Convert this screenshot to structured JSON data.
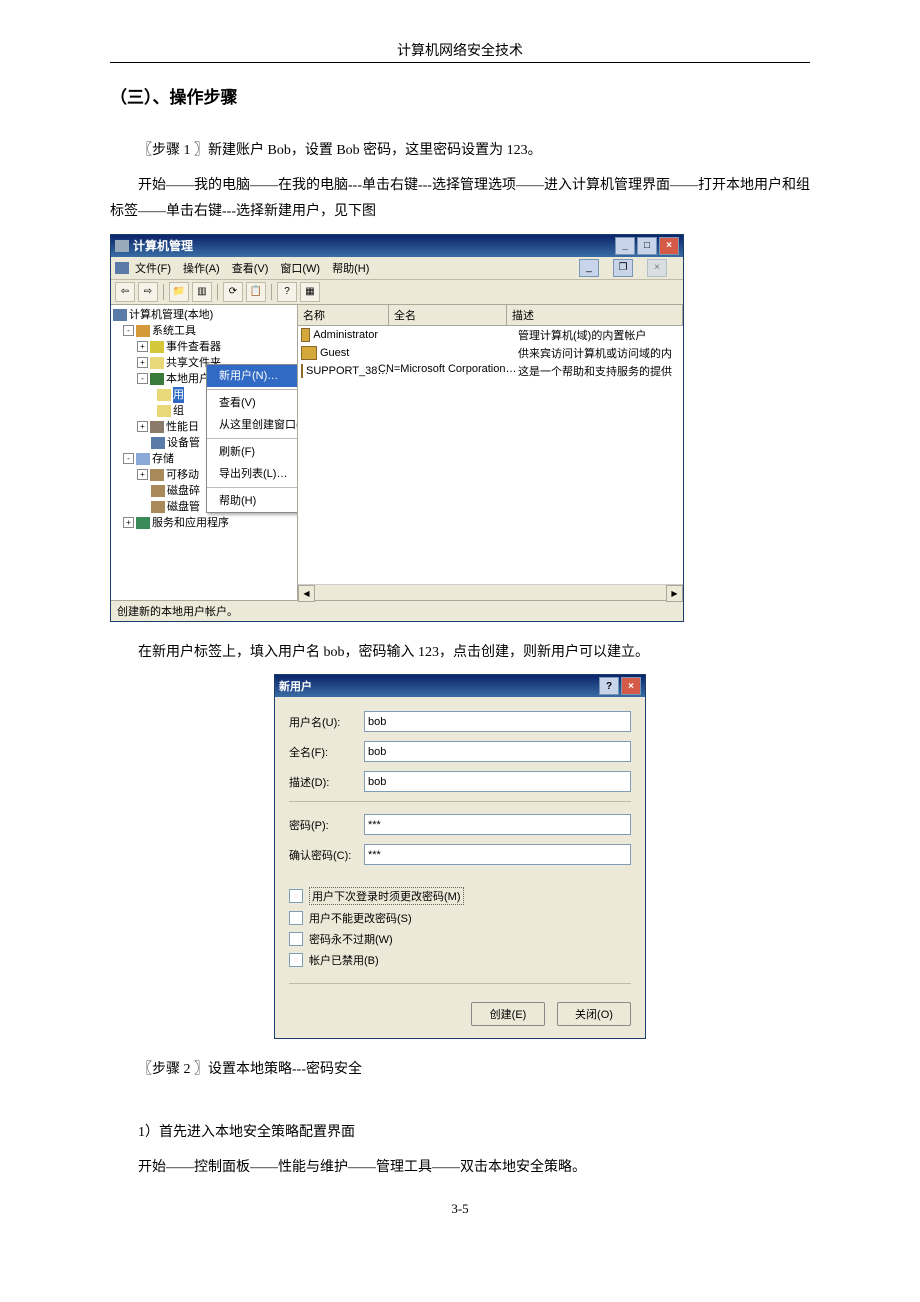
{
  "doc": {
    "header": "计算机网络安全技术",
    "section_title": "（三）、操作步骤",
    "step1_title": "〖步骤 1 〗新建账户 Bob，设置 Bob 密码，这里密码设置为 123。",
    "step1_p1": "开始——我的电脑——在我的电脑---单击右键---选择管理选项——进入计算机管理界面——打开本地用户和组标签——单击右键---选择新建用户，见下图",
    "step1_p2": "在新用户标签上，填入用户名 bob，密码输入 123，点击创建，则新用户可以建立。",
    "step2_title": "〖步骤 2 〗设置本地策略---密码安全",
    "step2_p1": "1）首先进入本地安全策略配置界面",
    "step2_p2": "开始——控制面板——性能与维护——管理工具——双击本地安全策略。",
    "footer": "3-5"
  },
  "cm": {
    "title": "计算机管理",
    "menu": {
      "file": "文件(F)",
      "action": "操作(A)",
      "view": "查看(V)",
      "window": "窗口(W)",
      "help": "帮助(H)"
    },
    "tree": {
      "root": "计算机管理(本地)",
      "systools": "系统工具",
      "event": "事件查看器",
      "shared": "共享文件夹",
      "localusers": "本地用户和组",
      "users": "用",
      "groups": "组",
      "perf": "性能日",
      "device": "设备管",
      "storage": "存储",
      "removable": "可移动",
      "diskdefrag": "磁盘碎",
      "diskmgmt": "磁盘管",
      "services": "服务和应用程序"
    },
    "cols": {
      "name": "名称",
      "fullname": "全名",
      "desc": "描述"
    },
    "users": [
      {
        "name": "Administrator",
        "full": "",
        "desc": "管理计算机(域)的内置帐户"
      },
      {
        "name": "Guest",
        "full": "",
        "desc": "供来宾访问计算机或访问域的内"
      },
      {
        "name": "SUPPORT_38…",
        "full": "CN=Microsoft Corporation…",
        "desc": "这是一个帮助和支持服务的提供"
      }
    ],
    "ctx": {
      "newuser": "新用户(N)…",
      "view": "查看(V)",
      "newwin": "从这里创建窗口(W)",
      "refresh": "刷新(F)",
      "export": "导出列表(L)…",
      "help": "帮助(H)"
    },
    "status": "创建新的本地用户帐户。"
  },
  "nu": {
    "title": "新用户",
    "lbl": {
      "user": "用户名(U):",
      "full": "全名(F):",
      "desc": "描述(D):",
      "pwd": "密码(P):",
      "cpwd": "确认密码(C):"
    },
    "val": {
      "user": "bob",
      "full": "bob",
      "desc": "bob",
      "pwd": "***",
      "cpwd": "***"
    },
    "chk": {
      "mustchange": "用户下次登录时须更改密码(M)",
      "cannotchange": "用户不能更改密码(S)",
      "noexpire": "密码永不过期(W)",
      "disabled": "帐户已禁用(B)"
    },
    "btn": {
      "create": "创建(E)",
      "close": "关闭(O)"
    }
  }
}
